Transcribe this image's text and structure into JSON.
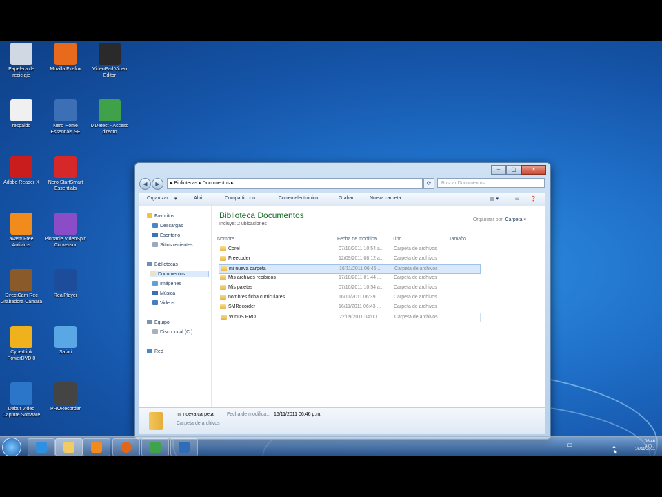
{
  "desktop_icons": [
    {
      "label": "Papelera de reciclaje",
      "color": "#cfd8e3"
    },
    {
      "label": "Mozilla Firefox",
      "color": "#e86a1c"
    },
    {
      "label": "VideoPad Video Editor",
      "color": "#2a2a2a"
    },
    {
      "label": "respaldo",
      "color": "#f0f0f0"
    },
    {
      "label": "Nero Home Essentials SE",
      "color": "#3c6fb6"
    },
    {
      "label": "MDetect - Acceso directo",
      "color": "#3fa24a"
    },
    {
      "label": "Adobe Reader X",
      "color": "#c91d1d"
    },
    {
      "label": "Nero StartSmart Essentials",
      "color": "#d62828"
    },
    {
      "label": "avast! Free Antivirus",
      "color": "#f08b1c"
    },
    {
      "label": "Pinnacle VideoSpin Conversor",
      "color": "#8b4dc7"
    },
    {
      "label": "DirectCam Rec Grabadora Cámara",
      "color": "#8a5a2b"
    },
    {
      "label": "RealPlayer",
      "color": "#1d4c9b"
    },
    {
      "label": "CyberLink PowerDVD 8",
      "color": "#f0b21c"
    },
    {
      "label": "Safari",
      "color": "#5aa7e6"
    },
    {
      "label": "Debut Video Capture Software",
      "color": "#2c76c9"
    },
    {
      "label": "PRORecorder",
      "color": "#444"
    }
  ],
  "window": {
    "address": [
      "Bibliotecas",
      "Documentos"
    ],
    "search_placeholder": "Buscar Documentos",
    "toolbar": {
      "organize": "Organizar",
      "open": "Abrir",
      "share": "Compartir con",
      "email": "Correo electrónico",
      "burn": "Grabar",
      "new_folder": "Nueva carpeta"
    },
    "nav": {
      "favorites": "Favoritos",
      "downloads": "Descargas",
      "desktop": "Escritorio",
      "recent": "Sitios recientes",
      "libraries": "Bibliotecas",
      "documents": "Documentos",
      "images": "Imágenes",
      "music": "Música",
      "videos": "Videos",
      "computer": "Equipo",
      "local_disk": "Disco local (C:)",
      "network": "Red"
    },
    "library_title": "Biblioteca Documentos",
    "library_sub": "Incluye: 2 ubicaciones",
    "arrange_label": "Organizar por:",
    "arrange_value": "Carpeta",
    "columns": {
      "name": "Nombre",
      "date": "Fecha de modifica...",
      "type": "Tipo",
      "size": "Tamaño"
    },
    "files": [
      {
        "name": "Corel",
        "date": "07/10/2011 10:54 a...",
        "type": "Carpeta de archivos"
      },
      {
        "name": "Freecoder",
        "date": "12/09/2011 08:12 a...",
        "type": "Carpeta de archivos"
      },
      {
        "name": "mi nueva carpeta",
        "date": "16/11/2011 06:46 ...",
        "type": "Carpeta de archivos"
      },
      {
        "name": "Mis archivos recibidos",
        "date": "17/10/2011 01:44 ...",
        "type": "Carpeta de archivos"
      },
      {
        "name": "Mis paletas",
        "date": "07/10/2011 10:54 a...",
        "type": "Carpeta de archivos"
      },
      {
        "name": "nombres ficha curriculares",
        "date": "16/11/2011 06:39 ...",
        "type": "Carpeta de archivos"
      },
      {
        "name": "SMRecorder",
        "date": "16/11/2011 06:43 ...",
        "type": "Carpeta de archivos"
      },
      {
        "name": "WinDS PRO",
        "date": "22/09/2011 04:00 ...",
        "type": "Carpeta de archivos"
      }
    ],
    "details": {
      "name": "mi nueva carpeta",
      "date_label": "Fecha de modifica...",
      "date_value": "16/11/2011 06:46 p.m.",
      "type": "Carpeta de archivos"
    }
  },
  "tray": {
    "lang": "ES",
    "time": "06:46 p.m.",
    "date": "16/11/2011"
  }
}
